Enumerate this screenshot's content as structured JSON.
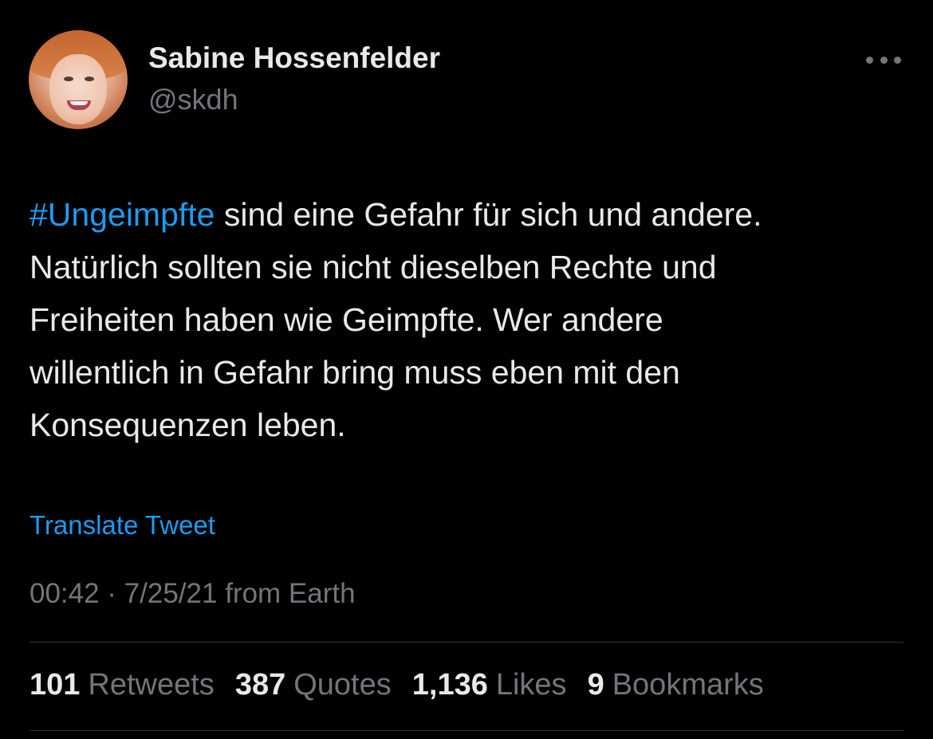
{
  "author": {
    "name": "Sabine Hossenfelder",
    "handle": "@skdh"
  },
  "tweet": {
    "hashtag": "#Ungeimpfte",
    "line1_rest": " sind eine Gefahr für sich und andere.",
    "line2": "Natürlich sollten sie nicht dieselben Rechte und",
    "line3": "Freiheiten haben wie Geimpfte. Wer andere",
    "line4": "willentlich in Gefahr bring muss eben mit den",
    "line5": "Konsequenzen leben."
  },
  "translate_label": "Translate Tweet",
  "meta": "00:42 · 7/25/21 from Earth",
  "stats": [
    {
      "count": "101",
      "label": "Retweets"
    },
    {
      "count": "387",
      "label": "Quotes"
    },
    {
      "count": "1,136",
      "label": "Likes"
    },
    {
      "count": "9",
      "label": "Bookmarks"
    }
  ],
  "icons": {
    "more": "more-horizontal-icon"
  },
  "colors": {
    "background": "#000000",
    "text": "#e7e9ea",
    "secondary": "#71767b",
    "accent": "#1d9bf0",
    "divider": "#2f3336"
  }
}
